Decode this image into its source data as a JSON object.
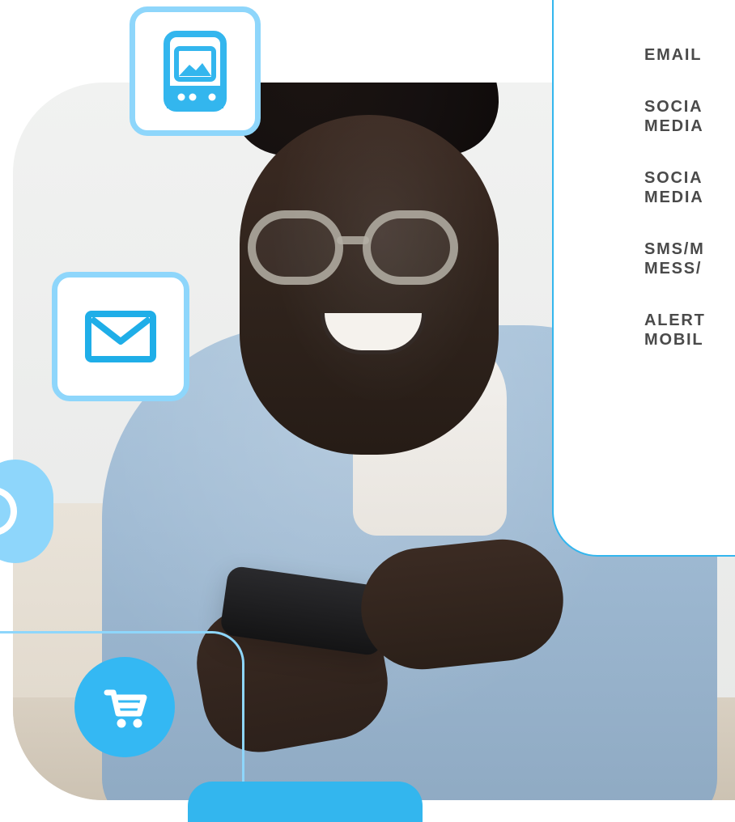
{
  "card": {
    "items": [
      {
        "label": "EMAIL"
      },
      {
        "label": "SOCIA\nMEDIA"
      },
      {
        "label": "SOCIA\nMEDIA"
      },
      {
        "label": "SMS/M\nMESS/"
      },
      {
        "label": "ALERT\nMOBIL"
      }
    ]
  },
  "icons": {
    "image_tile": "image-card-icon",
    "mail_tile": "mail-icon",
    "left_circle": "partial-icon",
    "cart_circle": "shopping-cart-icon"
  },
  "colors": {
    "accent": "#33b6ee",
    "accent_light": "#8ed6fb",
    "text": "#4a4a4a",
    "background": "#ffffff"
  }
}
